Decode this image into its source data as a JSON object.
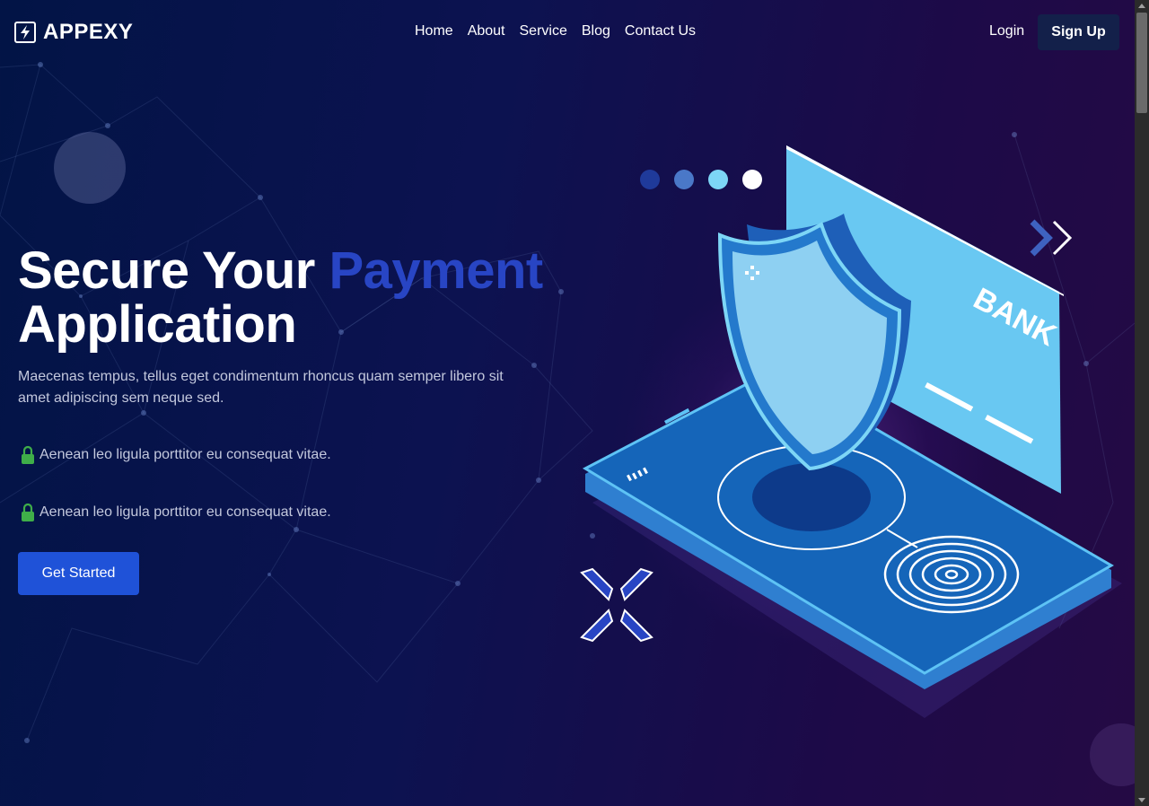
{
  "brand": {
    "name": "APPEXY",
    "icon": "bolt-icon"
  },
  "nav": {
    "items": [
      "Home",
      "About",
      "Service",
      "Blog",
      "Contact Us"
    ]
  },
  "auth": {
    "login": "Login",
    "signup": "Sign Up"
  },
  "hero": {
    "title_part1": "Secure Your",
    "title_highlight": "Payment",
    "title_part2": "Application",
    "description": "Maecenas tempus, tellus eget condimentum rhoncus quam semper libero sit amet adipiscing sem neque sed.",
    "features": [
      {
        "icon": "lock-icon",
        "text": "Aenean leo ligula porttitor eu consequat vitae."
      },
      {
        "icon": "lock-icon",
        "text": "Aenean leo ligula porttitor eu consequat vitae."
      }
    ],
    "cta": "Get Started"
  },
  "illustration": {
    "card_text": "BANK"
  },
  "colors": {
    "accent": "#2845c4",
    "button": "#1f52d8",
    "signup_bg": "#13204a",
    "lock": "#3fae49"
  }
}
